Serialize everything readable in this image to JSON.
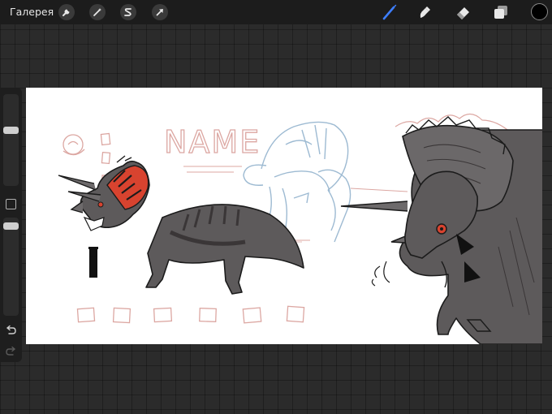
{
  "topbar": {
    "gallery_label": "Галерея",
    "left_tools": [
      {
        "icon": "wrench-icon",
        "name": "actions-button"
      },
      {
        "icon": "magic-wand-icon",
        "name": "adjustments-button"
      },
      {
        "icon": "selection-s-icon",
        "name": "selection-button"
      },
      {
        "icon": "arrow-cursor-icon",
        "name": "transform-button"
      }
    ],
    "right_tools": [
      {
        "icon": "brush-icon",
        "name": "brush-tool",
        "active": true
      },
      {
        "icon": "smudge-icon",
        "name": "smudge-tool",
        "active": false
      },
      {
        "icon": "eraser-icon",
        "name": "eraser-tool",
        "active": false
      },
      {
        "icon": "layers-icon",
        "name": "layers-button",
        "active": false
      }
    ],
    "current_color": "#000000",
    "active_tool_color": "#3d7eff"
  },
  "sidebar": {
    "brush_size_level": 0.62,
    "opacity_level": 0.95,
    "controls": [
      "modify-button",
      "undo-icon",
      "redo-icon"
    ]
  },
  "canvas": {
    "background": "#ffffff",
    "sketch_text": "NAME",
    "colors": {
      "sketch_red": "#dca7a2",
      "sketch_blue": "#9dbad2",
      "dino_gray": "#5d5a5b",
      "dino_dark": "#3a3637",
      "frill_red": "#d8432f",
      "line": "#1b1b1b"
    }
  }
}
